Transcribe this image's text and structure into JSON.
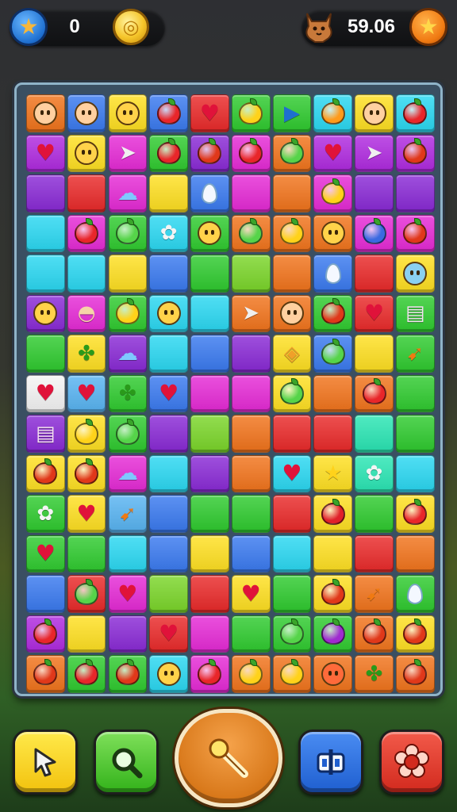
{
  "hud": {
    "star_count": "0",
    "timer": "59.06",
    "icons": {
      "left_badge": "star-icon",
      "coin": "gold-coin-icon",
      "character": "cat-icon",
      "right_badge": "star-icon"
    }
  },
  "board": {
    "columns": 10,
    "rows": 15,
    "colors": {
      "orange": "#f2741c",
      "blue": "#3a7af0",
      "yellow": "#ffe021",
      "red": "#ea2a2a",
      "green": "#2fcb2f",
      "lime": "#7bd62a",
      "cyan": "#2ad8f2",
      "purple": "#8a2ad6",
      "magenta": "#e62ad6",
      "pink": "#f25ab4",
      "violet": "#b02ae0",
      "teal": "#2ae6b4",
      "white": "#f4f4f4",
      "grey": "#7a8a9a",
      "skyblue": "#58b4f2"
    },
    "tiles": [
      [
        {
          "c": "orange",
          "i": "boy-face"
        },
        {
          "c": "blue",
          "i": "boy-face"
        },
        {
          "c": "yellow",
          "i": "smiley"
        },
        {
          "c": "blue",
          "i": "apple"
        },
        {
          "c": "red",
          "i": "heart"
        },
        {
          "c": "green",
          "i": "lemon"
        },
        {
          "c": "green",
          "i": "arrow"
        },
        {
          "c": "cyan",
          "i": "orange-fruit"
        },
        {
          "c": "yellow",
          "i": "girl-face"
        },
        {
          "c": "cyan",
          "i": "apple"
        }
      ],
      [
        {
          "c": "violet",
          "i": "heart"
        },
        {
          "c": "yellow",
          "i": "smiley"
        },
        {
          "c": "magenta",
          "i": "paper-plane"
        },
        {
          "c": "green",
          "i": "apple"
        },
        {
          "c": "purple",
          "i": "tomato"
        },
        {
          "c": "magenta",
          "i": "apple"
        },
        {
          "c": "orange",
          "i": "melon"
        },
        {
          "c": "violet",
          "i": "heart"
        },
        {
          "c": "violet",
          "i": "paper-plane"
        },
        {
          "c": "violet",
          "i": "tomato"
        }
      ],
      [
        {
          "c": "purple",
          "i": ""
        },
        {
          "c": "red",
          "i": ""
        },
        {
          "c": "magenta",
          "i": "cloud"
        },
        {
          "c": "yellow",
          "i": ""
        },
        {
          "c": "blue",
          "i": "drop"
        },
        {
          "c": "magenta",
          "i": ""
        },
        {
          "c": "orange",
          "i": ""
        },
        {
          "c": "magenta",
          "i": "lemon"
        },
        {
          "c": "purple",
          "i": ""
        },
        {
          "c": "purple",
          "i": ""
        }
      ],
      [
        {
          "c": "cyan",
          "i": ""
        },
        {
          "c": "magenta",
          "i": "apple"
        },
        {
          "c": "green",
          "i": "melon"
        },
        {
          "c": "cyan",
          "i": "flower"
        },
        {
          "c": "green",
          "i": "smiley"
        },
        {
          "c": "orange",
          "i": "melon"
        },
        {
          "c": "orange",
          "i": "lemon"
        },
        {
          "c": "orange",
          "i": "smiley"
        },
        {
          "c": "magenta",
          "i": "berry"
        },
        {
          "c": "magenta",
          "i": "tomato"
        }
      ],
      [
        {
          "c": "cyan",
          "i": ""
        },
        {
          "c": "cyan",
          "i": ""
        },
        {
          "c": "yellow",
          "i": ""
        },
        {
          "c": "blue",
          "i": ""
        },
        {
          "c": "green",
          "i": ""
        },
        {
          "c": "lime",
          "i": ""
        },
        {
          "c": "orange",
          "i": ""
        },
        {
          "c": "blue",
          "i": "drop"
        },
        {
          "c": "red",
          "i": ""
        },
        {
          "c": "yellow",
          "i": "sky-face"
        }
      ],
      [
        {
          "c": "purple",
          "i": "smiley"
        },
        {
          "c": "magenta",
          "i": "cupcake"
        },
        {
          "c": "green",
          "i": "lemon"
        },
        {
          "c": "cyan",
          "i": "smiley"
        },
        {
          "c": "cyan",
          "i": ""
        },
        {
          "c": "orange",
          "i": "paper-plane"
        },
        {
          "c": "orange",
          "i": "boy-face"
        },
        {
          "c": "green",
          "i": "tomato"
        },
        {
          "c": "red",
          "i": "heart"
        },
        {
          "c": "green",
          "i": "cake"
        }
      ],
      [
        {
          "c": "green",
          "i": ""
        },
        {
          "c": "yellow",
          "i": "broccoli"
        },
        {
          "c": "purple",
          "i": "cloud"
        },
        {
          "c": "cyan",
          "i": ""
        },
        {
          "c": "blue",
          "i": ""
        },
        {
          "c": "purple",
          "i": ""
        },
        {
          "c": "yellow",
          "i": "gem"
        },
        {
          "c": "blue",
          "i": "melon"
        },
        {
          "c": "yellow",
          "i": ""
        },
        {
          "c": "green",
          "i": "carrot"
        }
      ],
      [
        {
          "c": "white",
          "i": "heart"
        },
        {
          "c": "skyblue",
          "i": "heart"
        },
        {
          "c": "green",
          "i": "broccoli"
        },
        {
          "c": "blue",
          "i": "heart"
        },
        {
          "c": "magenta",
          "i": ""
        },
        {
          "c": "magenta",
          "i": ""
        },
        {
          "c": "yellow",
          "i": "melon"
        },
        {
          "c": "orange",
          "i": ""
        },
        {
          "c": "orange",
          "i": "apple"
        },
        {
          "c": "green",
          "i": ""
        }
      ],
      [
        {
          "c": "purple",
          "i": "cake"
        },
        {
          "c": "yellow",
          "i": "lemon"
        },
        {
          "c": "green",
          "i": "melon"
        },
        {
          "c": "purple",
          "i": ""
        },
        {
          "c": "lime",
          "i": ""
        },
        {
          "c": "orange",
          "i": ""
        },
        {
          "c": "red",
          "i": ""
        },
        {
          "c": "red",
          "i": ""
        },
        {
          "c": "teal",
          "i": ""
        },
        {
          "c": "green",
          "i": ""
        }
      ],
      [
        {
          "c": "yellow",
          "i": "tomato"
        },
        {
          "c": "yellow",
          "i": "tomato"
        },
        {
          "c": "magenta",
          "i": "cloud"
        },
        {
          "c": "cyan",
          "i": ""
        },
        {
          "c": "purple",
          "i": ""
        },
        {
          "c": "orange",
          "i": ""
        },
        {
          "c": "cyan",
          "i": "heart"
        },
        {
          "c": "yellow",
          "i": "star"
        },
        {
          "c": "teal",
          "i": "flower"
        },
        {
          "c": "cyan",
          "i": ""
        }
      ],
      [
        {
          "c": "green",
          "i": "flower"
        },
        {
          "c": "yellow",
          "i": "heart"
        },
        {
          "c": "skyblue",
          "i": "carrot"
        },
        {
          "c": "blue",
          "i": ""
        },
        {
          "c": "green",
          "i": ""
        },
        {
          "c": "green",
          "i": ""
        },
        {
          "c": "red",
          "i": ""
        },
        {
          "c": "yellow",
          "i": "strawberry"
        },
        {
          "c": "green",
          "i": ""
        },
        {
          "c": "yellow",
          "i": "apple"
        }
      ],
      [
        {
          "c": "green",
          "i": "heart"
        },
        {
          "c": "green",
          "i": ""
        },
        {
          "c": "cyan",
          "i": ""
        },
        {
          "c": "blue",
          "i": ""
        },
        {
          "c": "yellow",
          "i": ""
        },
        {
          "c": "blue",
          "i": ""
        },
        {
          "c": "cyan",
          "i": ""
        },
        {
          "c": "yellow",
          "i": ""
        },
        {
          "c": "red",
          "i": ""
        },
        {
          "c": "orange",
          "i": ""
        }
      ],
      [
        {
          "c": "blue",
          "i": ""
        },
        {
          "c": "red",
          "i": "melon"
        },
        {
          "c": "magenta",
          "i": "heart"
        },
        {
          "c": "lime",
          "i": ""
        },
        {
          "c": "red",
          "i": ""
        },
        {
          "c": "yellow",
          "i": "heart"
        },
        {
          "c": "green",
          "i": ""
        },
        {
          "c": "yellow",
          "i": "tomato"
        },
        {
          "c": "orange",
          "i": "carrot"
        },
        {
          "c": "green",
          "i": "drop"
        }
      ],
      [
        {
          "c": "violet",
          "i": "apple"
        },
        {
          "c": "yellow",
          "i": ""
        },
        {
          "c": "purple",
          "i": ""
        },
        {
          "c": "red",
          "i": "heart"
        },
        {
          "c": "magenta",
          "i": ""
        },
        {
          "c": "green",
          "i": ""
        },
        {
          "c": "green",
          "i": "melon"
        },
        {
          "c": "green",
          "i": "plum"
        },
        {
          "c": "orange",
          "i": "tomato"
        },
        {
          "c": "yellow",
          "i": "tomato"
        }
      ],
      [
        {
          "c": "orange",
          "i": "tomato"
        },
        {
          "c": "green",
          "i": "apple"
        },
        {
          "c": "green",
          "i": "tomato"
        },
        {
          "c": "cyan",
          "i": "smiley"
        },
        {
          "c": "magenta",
          "i": "apple"
        },
        {
          "c": "orange",
          "i": "lemon"
        },
        {
          "c": "orange",
          "i": "lemon"
        },
        {
          "c": "orange",
          "i": "red-face"
        },
        {
          "c": "orange",
          "i": "broccoli"
        },
        {
          "c": "orange",
          "i": "tomato"
        }
      ]
    ]
  },
  "toolbar": {
    "buttons": [
      {
        "name": "pointer-button",
        "icon": "cursor-icon"
      },
      {
        "name": "search-button",
        "icon": "magnifier-icon"
      },
      {
        "name": "hint-button",
        "icon": "magic-wand-icon"
      },
      {
        "name": "shuffle-button",
        "icon": "split-icon"
      },
      {
        "name": "settings-button",
        "icon": "gear-flower-icon"
      }
    ]
  }
}
